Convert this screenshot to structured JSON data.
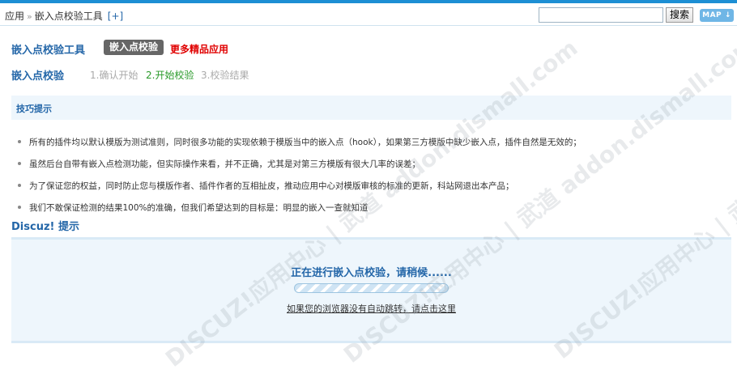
{
  "topbar": {
    "breadcrumb_app": "应用",
    "breadcrumb_sep": "»",
    "breadcrumb_current": "嵌入点校验工具",
    "add_link": "[+]",
    "search_placeholder": "",
    "search_button": "搜索",
    "map_button": "MAP"
  },
  "header": {
    "tool_title": "嵌入点校验工具",
    "tool_badge": "嵌入点校验",
    "more_link": "更多精品应用"
  },
  "steps": {
    "section_title": "嵌入点校验",
    "items": [
      "1.确认开始",
      "2.开始校验",
      "3.校验结果"
    ],
    "active_index": 1
  },
  "tips": {
    "header": "技巧提示",
    "items": [
      "所有的插件均以默认模版为测试准则，同时很多功能的实现依赖于模版当中的嵌入点（hook），如果第三方模版中缺少嵌入点，插件自然是无效的；",
      "虽然后台自带有嵌入点检测功能，但实际操作来看，并不正确，尤其是对第三方模版有很大几率的误差；",
      "为了保证您的权益，同时防止您与模版作者、插件作者的互相扯皮，推动应用中心对模版审核的标准的更新，科站网退出本产品；",
      "我们不敢保证检测的结果100%的准确，但我们希望达到的目标是：明显的嵌入一查就知道"
    ]
  },
  "message": {
    "title": "Discuz! 提示",
    "text": "正在进行嵌入点校验，请稍候......",
    "redirect_link": "如果您的浏览器没有自动跳转，请点击这里",
    "watermark": "DISCUZ!应用中心 | 武道 addon.dismall.com"
  },
  "colors": {
    "accent": "#2366a8",
    "top_stripe": "#1d8fd4",
    "panel_bg": "#eef6fc",
    "link_red": "#e00000",
    "step_active": "#2a9a2a"
  }
}
